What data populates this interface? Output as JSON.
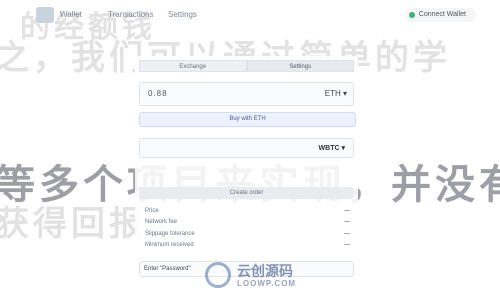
{
  "background_text": {
    "line1": "的经额钱",
    "line2": "之，我们可以通过简单的学",
    "line3": "等多个项目来实现，并没有过",
    "line4": "获得回报"
  },
  "nav": {
    "app_title": "Wallet",
    "links": [
      "Wallet",
      "Transactions",
      "Settings"
    ],
    "connect_label": "Connect Wallet"
  },
  "card": {
    "tabs": [
      {
        "label": "Exchange",
        "active": false
      },
      {
        "label": "Settings",
        "active": true
      }
    ],
    "amount_value": "0.88",
    "amount_token": "ETH",
    "buy_button": "Buy with ETH",
    "receive_token": "WBTC",
    "create_button": "Create order",
    "rows": [
      {
        "label": "Price",
        "value": "—"
      },
      {
        "label": "Network fee",
        "value": "—"
      },
      {
        "label": "Slippage tolerance",
        "value": "—"
      },
      {
        "label": "Minimum received",
        "value": "—"
      }
    ],
    "password_placeholder": "Enter \"Password\""
  },
  "watermark": {
    "title": "云创源码",
    "subtitle": "LOOWP.COM"
  },
  "colors": {
    "accent": "#4a5a9a",
    "connected": "#3bb27a"
  }
}
